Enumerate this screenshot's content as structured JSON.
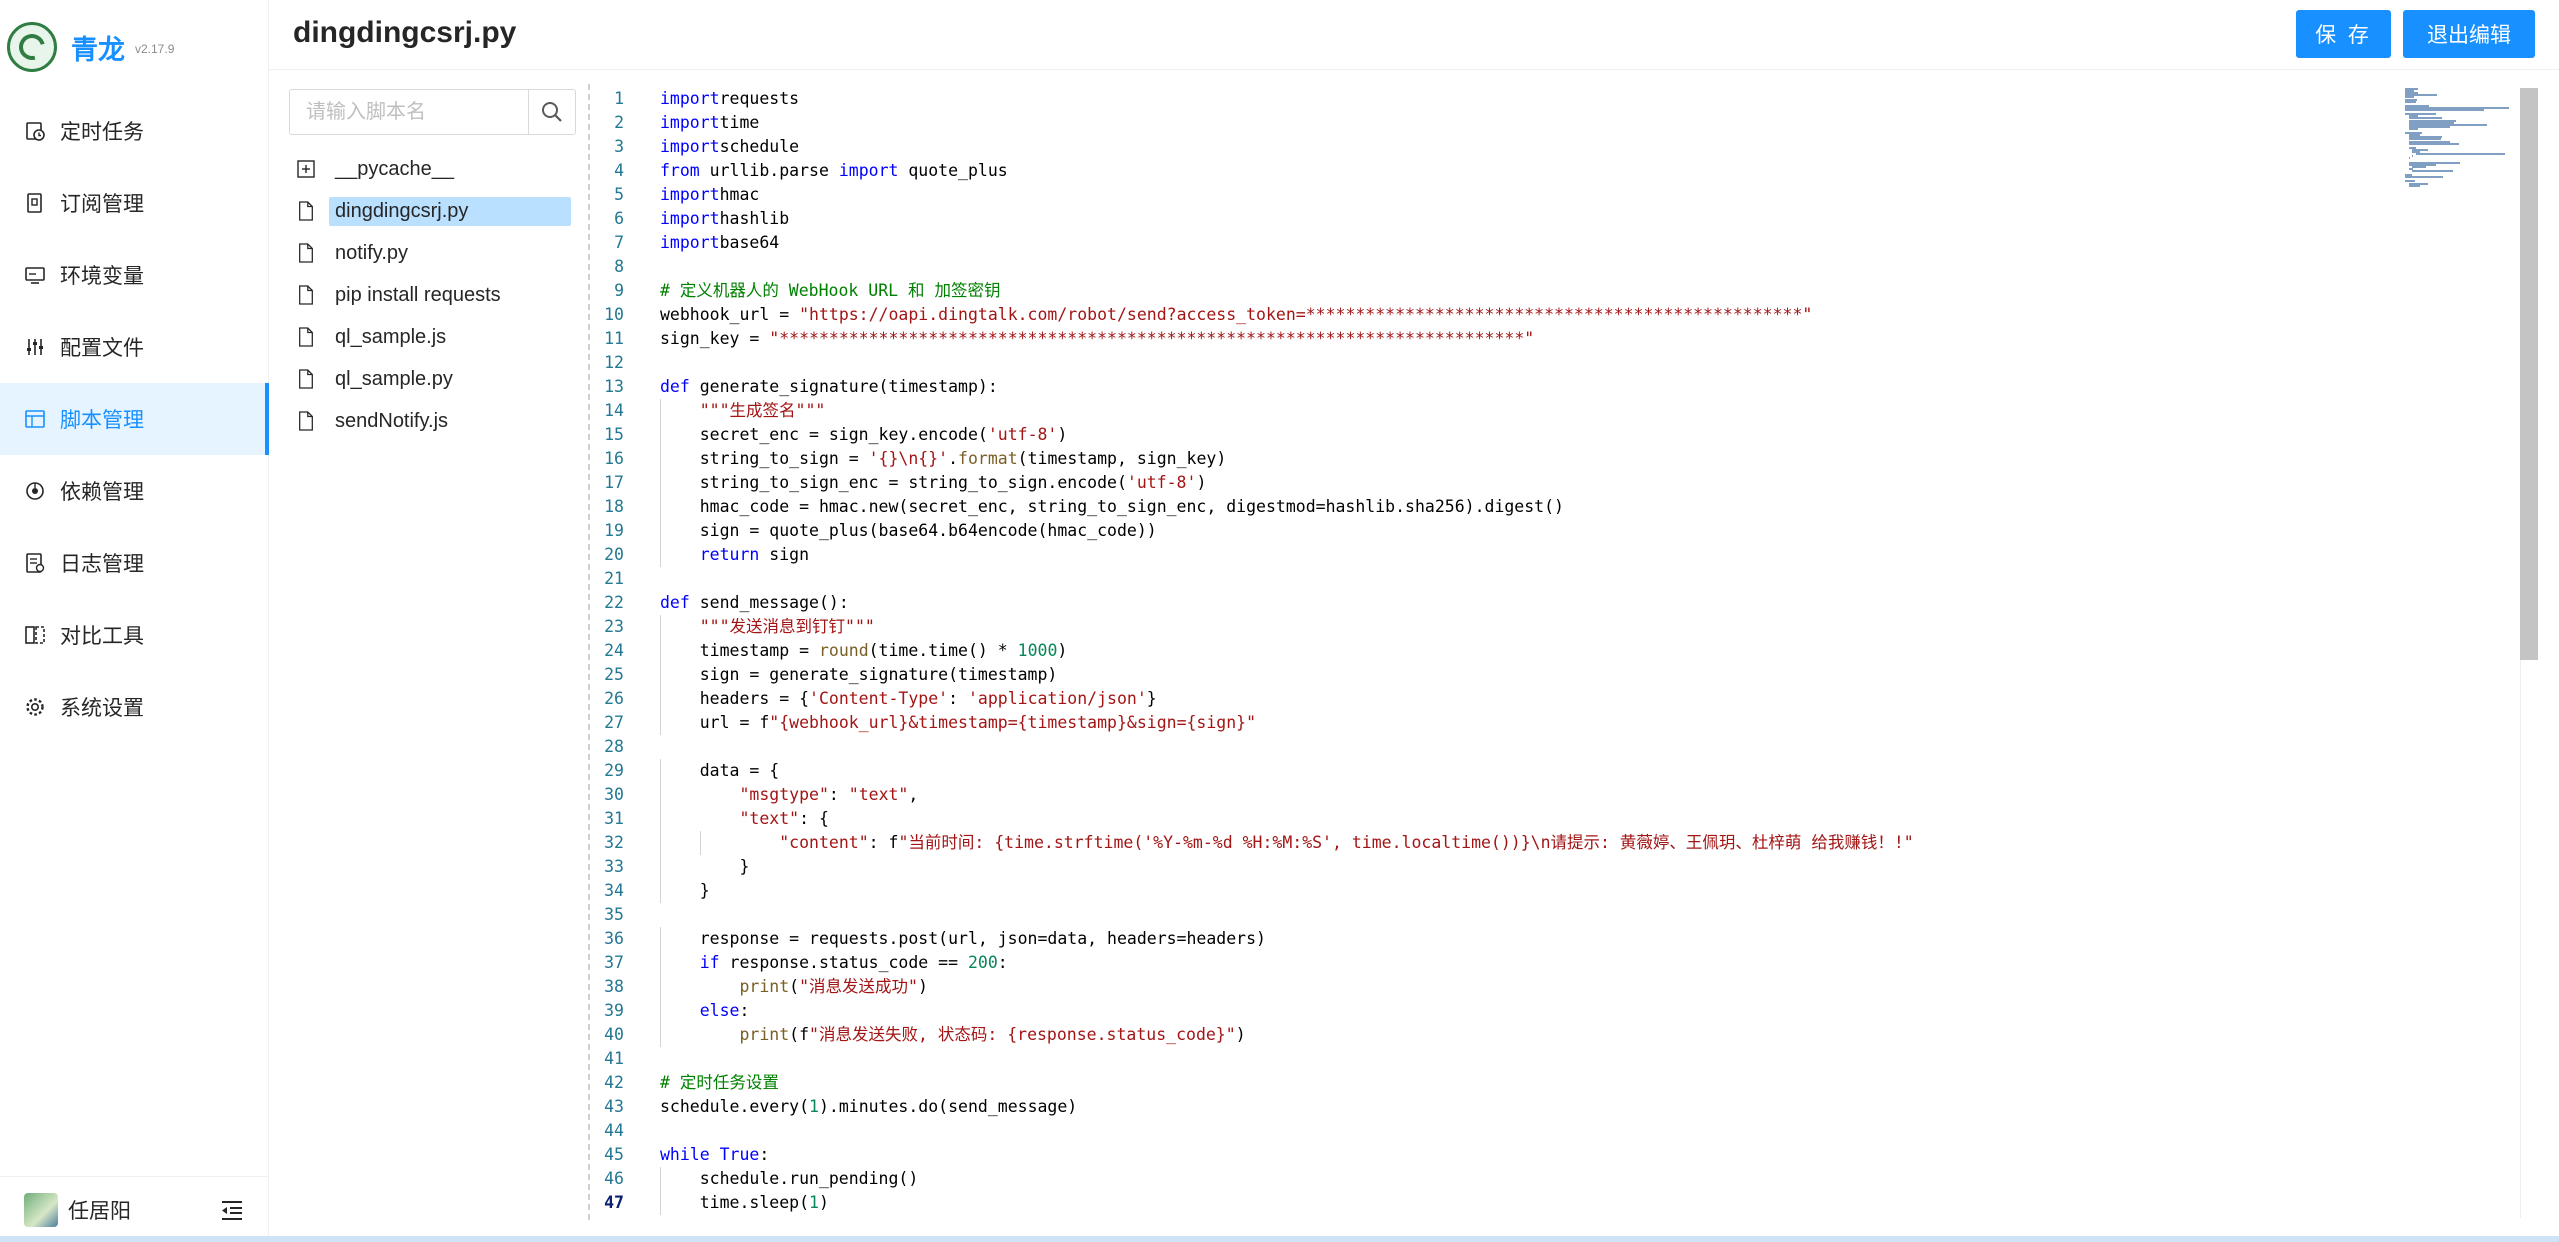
{
  "app": {
    "name": "青龙",
    "version": "v2.17.9"
  },
  "menu": [
    {
      "label": "定时任务",
      "icon": "clock-icon",
      "active": false
    },
    {
      "label": "订阅管理",
      "icon": "subscription-icon",
      "active": false
    },
    {
      "label": "环境变量",
      "icon": "monitor-icon",
      "active": false
    },
    {
      "label": "配置文件",
      "icon": "sliders-icon",
      "active": false
    },
    {
      "label": "脚本管理",
      "icon": "script-icon",
      "active": true
    },
    {
      "label": "依赖管理",
      "icon": "dependency-icon",
      "active": false
    },
    {
      "label": "日志管理",
      "icon": "log-icon",
      "active": false
    },
    {
      "label": "对比工具",
      "icon": "diff-icon",
      "active": false
    },
    {
      "label": "系统设置",
      "icon": "gear-icon",
      "active": false
    }
  ],
  "user": {
    "name": "任居阳"
  },
  "header": {
    "title": "dingdingcsrj.py",
    "save_label": "保 存",
    "exit_label": "退出编辑"
  },
  "search": {
    "placeholder": "请输入脚本名"
  },
  "files": [
    {
      "name": "__pycache__",
      "type": "folder",
      "selected": false
    },
    {
      "name": "dingdingcsrj.py",
      "type": "file",
      "selected": true
    },
    {
      "name": "notify.py",
      "type": "file",
      "selected": false
    },
    {
      "name": "pip install requests",
      "type": "file",
      "selected": false
    },
    {
      "name": "ql_sample.js",
      "type": "file",
      "selected": false
    },
    {
      "name": "ql_sample.py",
      "type": "file",
      "selected": false
    },
    {
      "name": "sendNotify.js",
      "type": "file",
      "selected": false
    }
  ],
  "editor": {
    "current_line": 47,
    "lines": [
      [
        [
          "kw",
          "import"
        ],
        [
          "",
          "requests"
        ]
      ],
      [
        [
          "kw",
          "import"
        ],
        [
          "",
          "time"
        ]
      ],
      [
        [
          "kw",
          "import"
        ],
        [
          "",
          "schedule"
        ]
      ],
      [
        [
          "kw",
          "from"
        ],
        [
          "",
          " urllib.parse "
        ],
        [
          "kw",
          "import"
        ],
        [
          "",
          " quote_plus"
        ]
      ],
      [
        [
          "kw",
          "import"
        ],
        [
          "",
          "hmac"
        ]
      ],
      [
        [
          "kw",
          "import"
        ],
        [
          "",
          "hashlib"
        ]
      ],
      [
        [
          "kw",
          "import"
        ],
        [
          "",
          "base64"
        ]
      ],
      [],
      [
        [
          "cmt",
          "# 定义机器人的 WebHook URL 和 加签密钥"
        ]
      ],
      [
        [
          "",
          "webhook_url = "
        ],
        [
          "str",
          "\"https://oapi.dingtalk.com/robot/send?access_token=**************************************************\""
        ]
      ],
      [
        [
          "",
          "sign_key = "
        ],
        [
          "str",
          "\"***************************************************************************\""
        ]
      ],
      [],
      [
        [
          "kw",
          "def"
        ],
        [
          "",
          " generate_signature(timestamp):"
        ]
      ],
      [
        [
          "",
          "    "
        ],
        [
          "str",
          "\"\"\"生成签名\"\"\""
        ]
      ],
      [
        [
          "",
          "    secret_enc = sign_key.encode("
        ],
        [
          "str",
          "'utf-8'"
        ],
        [
          "",
          ")"
        ]
      ],
      [
        [
          "",
          "    string_to_sign = "
        ],
        [
          "str",
          "'{}\\n{}'"
        ],
        [
          "",
          ".",
          ""
        ],
        [
          "fn",
          "format"
        ],
        [
          "",
          "(timestamp, sign_key)"
        ]
      ],
      [
        [
          "",
          "    string_to_sign_enc = string_to_sign.encode("
        ],
        [
          "str",
          "'utf-8'"
        ],
        [
          "",
          ")"
        ]
      ],
      [
        [
          "",
          "    hmac_code = hmac.new(secret_enc, string_to_sign_enc, digestmod=hashlib.sha256).digest()"
        ]
      ],
      [
        [
          "",
          "    sign = quote_plus(base64.b64encode(hmac_code))"
        ]
      ],
      [
        [
          "",
          "    "
        ],
        [
          "kw",
          "return"
        ],
        [
          "",
          " sign"
        ]
      ],
      [],
      [
        [
          "kw",
          "def"
        ],
        [
          "",
          " send_message():"
        ]
      ],
      [
        [
          "",
          "    "
        ],
        [
          "str",
          "\"\"\"发送消息到钉钉\"\"\""
        ]
      ],
      [
        [
          "",
          "    timestamp = "
        ],
        [
          "fn",
          "round"
        ],
        [
          "",
          "(time.time() * "
        ],
        [
          "num",
          "1000"
        ],
        [
          "",
          ")"
        ]
      ],
      [
        [
          "",
          "    sign = generate_signature(timestamp)"
        ]
      ],
      [
        [
          "",
          "    headers = {"
        ],
        [
          "str",
          "'Content-Type'"
        ],
        [
          "",
          ": "
        ],
        [
          "str",
          "'application/json'"
        ],
        [
          "",
          "}"
        ]
      ],
      [
        [
          "",
          "    url = f"
        ],
        [
          "str",
          "\"{webhook_url}&timestamp={timestamp}&sign={sign}\""
        ]
      ],
      [],
      [
        [
          "",
          "    data = {"
        ]
      ],
      [
        [
          "",
          "        "
        ],
        [
          "str",
          "\"msgtype\""
        ],
        [
          "",
          ": "
        ],
        [
          "str",
          "\"text\""
        ],
        [
          "",
          ","
        ]
      ],
      [
        [
          "",
          "        "
        ],
        [
          "str",
          "\"text\""
        ],
        [
          "",
          ": {"
        ]
      ],
      [
        [
          "",
          "            "
        ],
        [
          "str",
          "\"content\""
        ],
        [
          "",
          ": f"
        ],
        [
          "str",
          "\"当前时间: {time.strftime('%Y-%m-%d %H:%M:%S', time.localtime())}\\n请提示: 黄薇婷、王佩玥、杜梓萌 给我赚钱！!\""
        ]
      ],
      [
        [
          "",
          "        }"
        ]
      ],
      [
        [
          "",
          "    }"
        ]
      ],
      [],
      [
        [
          "",
          "    response = requests.post(url, json=data, headers=headers)"
        ]
      ],
      [
        [
          "",
          "    "
        ],
        [
          "kw",
          "if"
        ],
        [
          "",
          " response.status_code == "
        ],
        [
          "num",
          "200"
        ],
        [
          "",
          ":"
        ]
      ],
      [
        [
          "",
          "        "
        ],
        [
          "fn",
          "print"
        ],
        [
          "",
          "("
        ],
        [
          "str",
          "\"消息发送成功\""
        ],
        [
          "",
          ")"
        ]
      ],
      [
        [
          "",
          "    "
        ],
        [
          "kw",
          "else"
        ],
        [
          "",
          ":"
        ]
      ],
      [
        [
          "",
          "        "
        ],
        [
          "fn",
          "print"
        ],
        [
          "",
          "(f"
        ],
        [
          "str",
          "\"消息发送失败, 状态码: {response.status_code}\""
        ],
        [
          "",
          ")"
        ]
      ],
      [],
      [
        [
          "cmt",
          "# 定时任务设置"
        ]
      ],
      [
        [
          "",
          "schedule.every("
        ],
        [
          "num",
          "1"
        ],
        [
          "",
          ").minutes.do(send_message)"
        ]
      ],
      [],
      [
        [
          "kw",
          "while"
        ],
        [
          "",
          " "
        ],
        [
          "kw",
          "True"
        ],
        [
          "",
          ":"
        ]
      ],
      [
        [
          "",
          "    schedule.run_pending()"
        ]
      ],
      [
        [
          "",
          "    time.sleep("
        ],
        [
          "num",
          "1"
        ],
        [
          "",
          ")"
        ]
      ]
    ]
  }
}
